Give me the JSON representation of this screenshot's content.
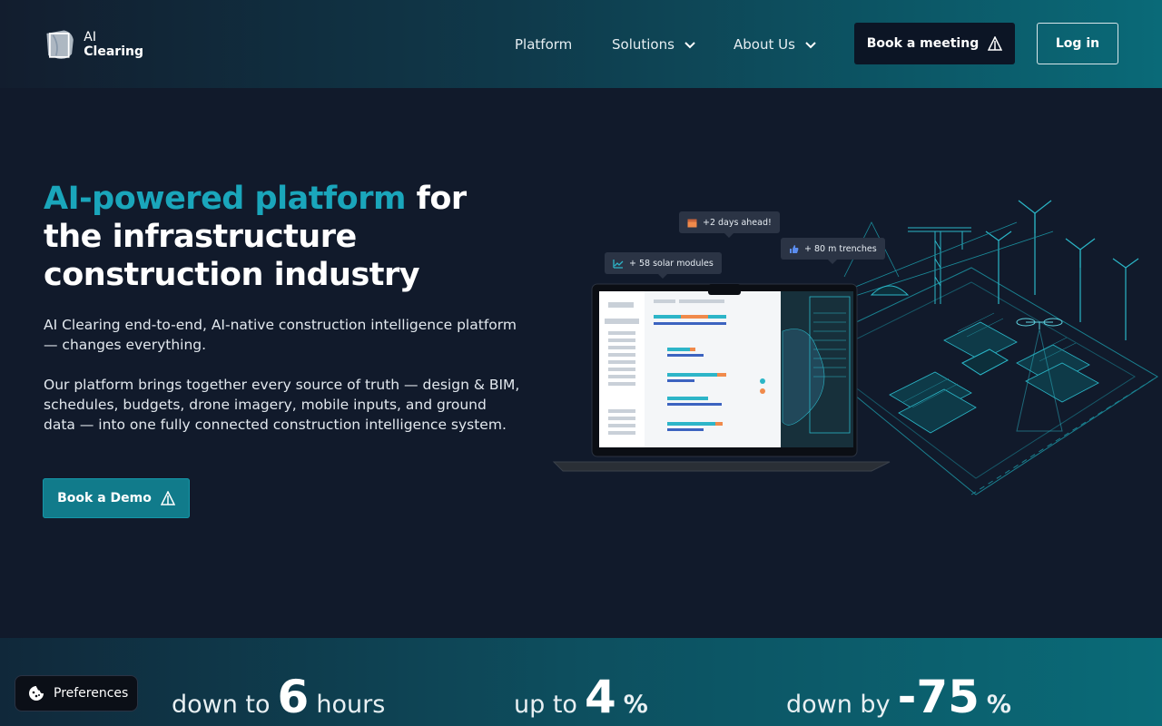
{
  "brand": {
    "line1": "AI",
    "line2": "Clearing"
  },
  "nav": {
    "platform": "Platform",
    "solutions": "Solutions",
    "about": "About Us",
    "book_meeting": "Book a meeting",
    "login": "Log in"
  },
  "hero": {
    "title_accent": "AI-powered platform",
    "title_rest": " for the infrastructure construction industry",
    "p1": "AI Clearing end-to-end, AI-native construction intelligence platform — changes everything.",
    "p2": "Our platform brings together every source of truth — design & BIM, schedules, budgets, drone imagery, mobile inputs, and ground data — into one fully connected construction intelligence system.",
    "cta": "Book a Demo"
  },
  "illustration": {
    "tip_days": "+2 days ahead!",
    "tip_solar": "+ 58 solar modules",
    "tip_trench": "+ 80 m trenches"
  },
  "stats": [
    {
      "pre": "down to",
      "num": "6",
      "unit": "hours"
    },
    {
      "pre": "up to",
      "num": "4",
      "unit": "%"
    },
    {
      "pre": "down by",
      "num": "-75",
      "unit": "%"
    }
  ],
  "prefs": {
    "label": "Preferences"
  },
  "colors": {
    "accent": "#1aa6bb",
    "bg": "#111a2b",
    "teal_button": "#117b8b"
  }
}
